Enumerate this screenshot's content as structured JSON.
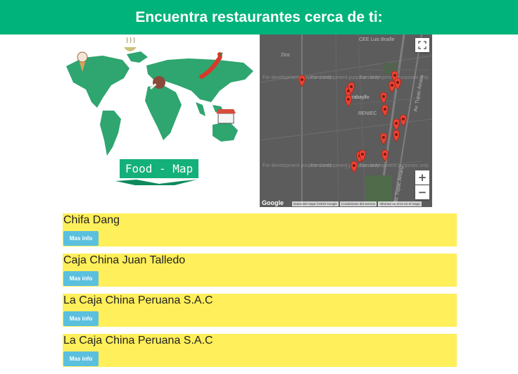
{
  "header": {
    "title": "Encuentra restaurantes cerca de ti:"
  },
  "logo": {
    "label": "Food - Map"
  },
  "map": {
    "watermark": "For development purposes only",
    "street_labels": [
      "Zinc",
      "CEE Luis Braille",
      "Carabayllo",
      "RENIEC",
      "Av. Tupac Amaru",
      "Av. Tupac Amaru"
    ],
    "fullscreen_icon": "fullscreen-icon",
    "zoom_in_label": "+",
    "zoom_out_label": "−",
    "google_label": "Google",
    "credits": [
      "Datos del mapa ©2019 Google",
      "Condiciones del servicio",
      "Informar un error en el mapa"
    ],
    "marker_color": "#ea4335"
  },
  "restaurants": [
    {
      "name": "Chifa Dang",
      "button": "Mas info"
    },
    {
      "name": "Caja China Juan Talledo",
      "button": "Mas info"
    },
    {
      "name": "La Caja China Peruana S.A.C",
      "button": "Mas info"
    },
    {
      "name": "La Caja China Peruana S.A.C",
      "button": "Mas info"
    }
  ],
  "colors": {
    "header": "#00b37a",
    "card": "#ffef5a",
    "button": "#5bc0de"
  }
}
